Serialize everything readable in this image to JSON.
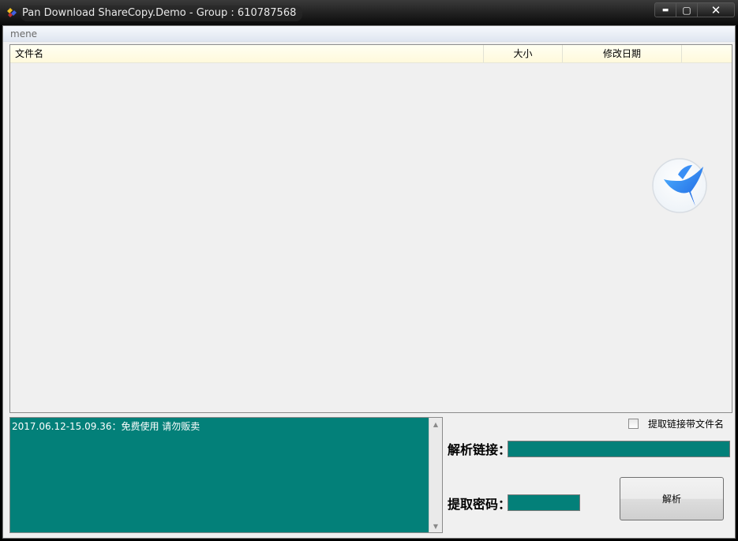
{
  "window": {
    "title": "Pan Download ShareCopy.Demo - Group : 610787568",
    "minimize": "▬",
    "maximize": "▢",
    "close": "✕"
  },
  "menubar": {
    "items": [
      {
        "label": "mene"
      }
    ]
  },
  "file_list": {
    "columns": [
      {
        "label": "文件名"
      },
      {
        "label": "大小"
      },
      {
        "label": "修改日期"
      },
      {
        "label": ""
      }
    ],
    "rows": []
  },
  "log": {
    "text": "2017.06.12-15.09.36：免费使用 请勿贩卖"
  },
  "options": {
    "checkbox_label": "提取链接带文件名",
    "checked": false
  },
  "form": {
    "link_label": "解析链接：",
    "link_value": "",
    "password_label": "提取密码：",
    "password_value": "",
    "parse_button": "解析"
  },
  "colors": {
    "accent_teal": "#038079"
  },
  "icons": {
    "app": "app-icon",
    "logo": "bird-logo-icon"
  }
}
